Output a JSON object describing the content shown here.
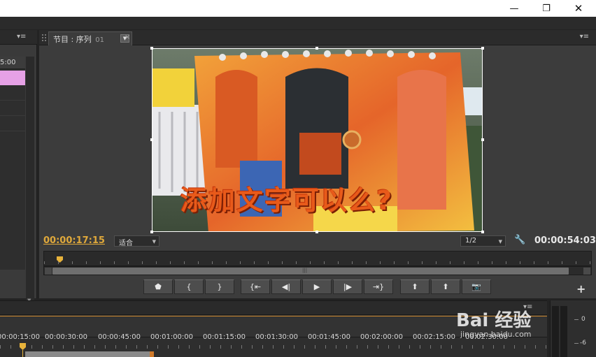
{
  "window": {
    "minimize_icon": "minimize-icon",
    "minimize_glyph": "—",
    "maximize_glyph": "❐",
    "close_glyph": "✕"
  },
  "left_panel": {
    "timecode": "5:00",
    "menu_glyph": "▾≡"
  },
  "program_monitor": {
    "tab_label": "节目 : 序列",
    "tab_number": "01",
    "tab_close": "×",
    "menu_glyph": "▾≡",
    "caption": "添加文字可以么?",
    "current_time": "00:00:17:15",
    "fit_option": "适合",
    "resolution_option": "1/2",
    "duration": "00:00:54:03",
    "add_glyph": "+",
    "buttons": [
      {
        "name": "add-marker-button",
        "glyph": "⬟"
      },
      {
        "name": "mark-in-button",
        "glyph": "{"
      },
      {
        "name": "mark-out-button",
        "glyph": "}"
      },
      {
        "name": "go-to-in-button",
        "glyph": "{⇤"
      },
      {
        "name": "step-back-button",
        "glyph": "◀|"
      },
      {
        "name": "play-button",
        "glyph": "▶"
      },
      {
        "name": "step-forward-button",
        "glyph": "|▶"
      },
      {
        "name": "go-to-out-button",
        "glyph": "⇥}"
      },
      {
        "name": "lift-button",
        "glyph": "⬆"
      },
      {
        "name": "extract-button",
        "glyph": "⬆"
      },
      {
        "name": "export-frame-button",
        "glyph": "📷"
      }
    ],
    "accent_color": "#e0a93b"
  },
  "timeline": {
    "menu_glyph": "▾≡",
    "ruler_labels": [
      "00:00:15:00",
      "00:00:30:00",
      "00:00:45:00",
      "00:01:00:00",
      "00:01:15:00",
      "00:01:30:00",
      "00:01:45:00",
      "00:02:00:00",
      "00:02:15:00",
      "00:02:30:00"
    ]
  },
  "audio_meter": {
    "label_0": "0",
    "label_minus6": "-6"
  },
  "watermark": {
    "text": "Bai 经验",
    "url": "jingyan.baidu.com"
  }
}
